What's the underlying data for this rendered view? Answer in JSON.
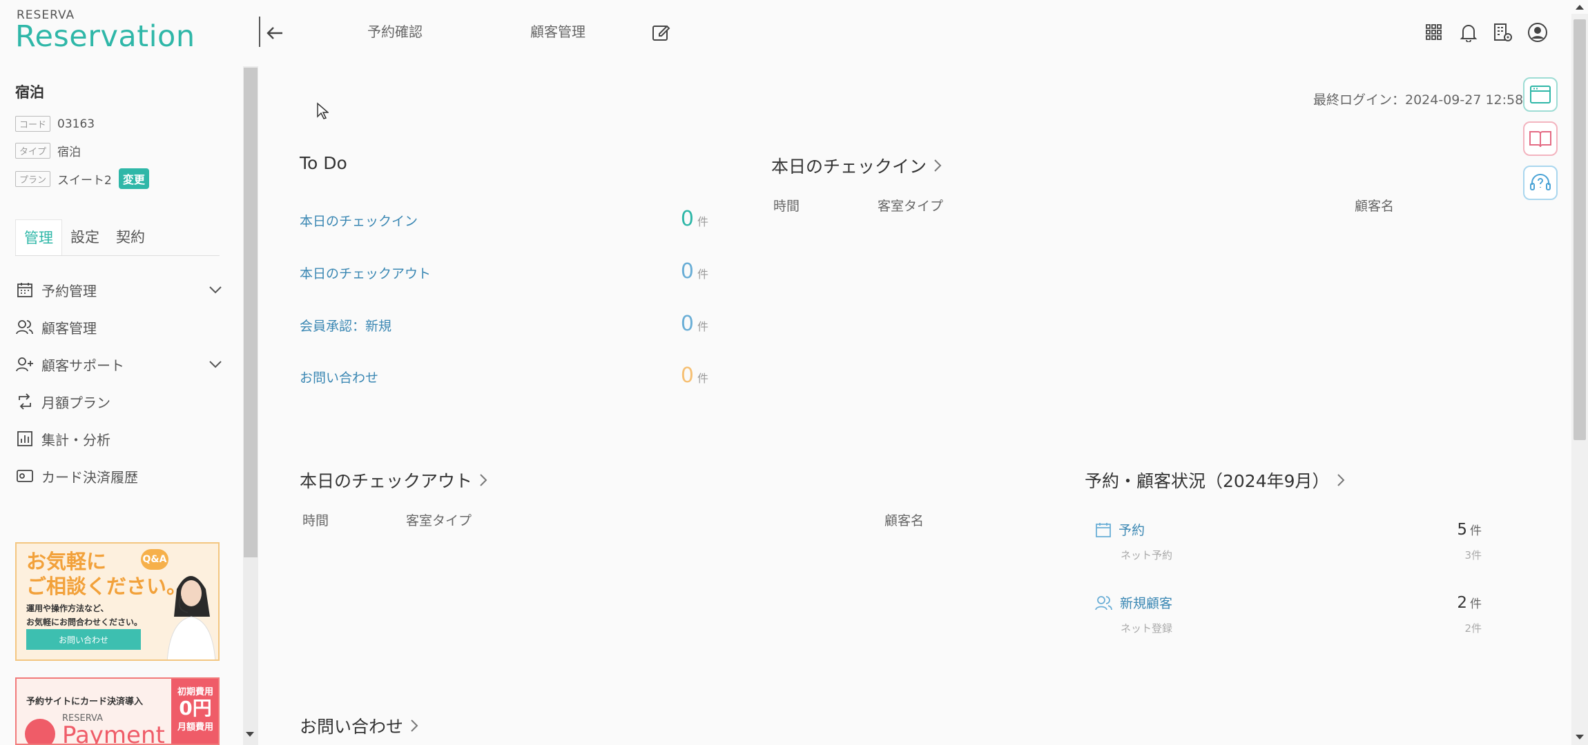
{
  "brand": {
    "small": "RESERVA",
    "name": "Reservation"
  },
  "header": {
    "links": [
      "予約確認",
      "顧客管理"
    ]
  },
  "sidebar": {
    "title": "宿泊",
    "meta": [
      {
        "tag": "コード",
        "value": "03163"
      },
      {
        "tag": "タイプ",
        "value": "宿泊"
      },
      {
        "tag": "プラン",
        "value": "スイート2"
      }
    ],
    "change_label": "変更",
    "tabs": [
      "管理",
      "設定",
      "契約"
    ],
    "nav": [
      "予約管理",
      "顧客管理",
      "顧客サポート",
      "月額プラン",
      "集計・分析",
      "カード決済履歴"
    ],
    "banner1": {
      "line1": "お気軽に",
      "line2": "ご相談ください。",
      "badge": "Q&A",
      "text1": "運用や操作方法など、",
      "text2": "お気軽にお問合わせください。",
      "button": "お問い合わせ"
    },
    "banner2": {
      "text": "予約サイトにカード決済導入",
      "brand": "RESERVA",
      "product": "Payment",
      "side1": "初期費用",
      "side_value": "0円",
      "side2": "月額費用"
    }
  },
  "main": {
    "last_login": "最終ログイン：2024-09-27 12:58",
    "todo": {
      "title": "To Do",
      "items": [
        {
          "label": "本日のチェックイン",
          "value": "0",
          "unit": "件",
          "color": "#2fb7a8"
        },
        {
          "label": "本日のチェックアウト",
          "value": "0",
          "unit": "件",
          "color": "#6aaed6"
        },
        {
          "label": "会員承認：新規",
          "value": "0",
          "unit": "件",
          "color": "#6aaed6"
        },
        {
          "label": "お問い合わせ",
          "value": "0",
          "unit": "件",
          "color": "#f6c074"
        }
      ]
    },
    "checkin": {
      "title": "本日のチェックイン",
      "cols": [
        "時間",
        "客室タイプ",
        "顧客名"
      ]
    },
    "checkout": {
      "title": "本日のチェックアウト",
      "cols": [
        "時間",
        "客室タイプ",
        "顧客名"
      ]
    },
    "status": {
      "title": "予約・顧客状況（2024年9月）",
      "rows": [
        {
          "label": "予約",
          "value": "5",
          "unit": "件",
          "sub_label": "ネット予約",
          "sub_value": "3件"
        },
        {
          "label": "新規顧客",
          "value": "2",
          "unit": "件",
          "sub_label": "ネット登録",
          "sub_value": "2件"
        }
      ]
    },
    "inquiry": {
      "title": "お問い合わせ"
    }
  }
}
